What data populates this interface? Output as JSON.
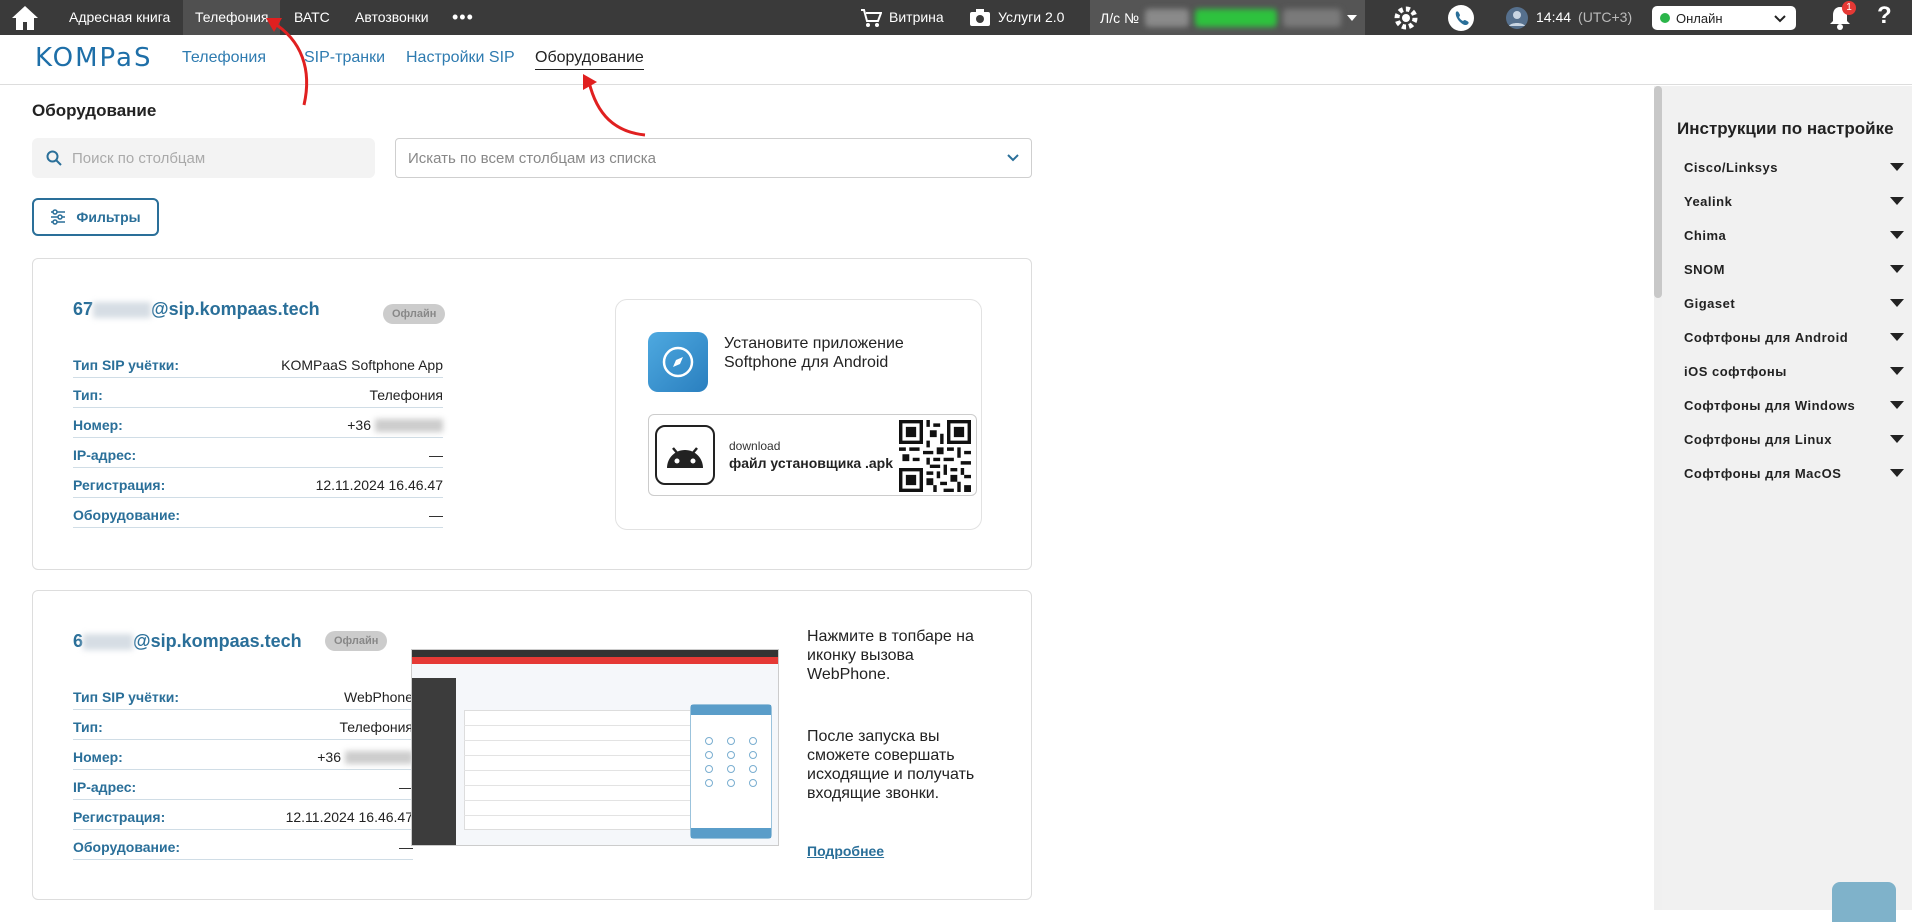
{
  "topbar": {
    "nav": [
      "Адресная книга",
      "Телефония",
      "ВАТС",
      "Автозвонки"
    ],
    "more": "•••",
    "vitrina": "Витрина",
    "services": "Услуги 2.0",
    "ls_label": "Л/с №",
    "time": "14:44",
    "tz": "(UTC+3)",
    "status": "Онлайн",
    "notif_count": "1",
    "help": "?"
  },
  "subnav": {
    "logo": "KOMPaS",
    "tabs": [
      "Телефония",
      "SIP-транки",
      "Настройки SIP",
      "Оборудование"
    ]
  },
  "main": {
    "title": "Оборудование",
    "search_placeholder": "Поиск по столбцам",
    "select_placeholder": "Искать по всем столбцам из списка",
    "filters": "Фильтры"
  },
  "cards": [
    {
      "acct_prefix": "67",
      "acct_suffix": "@sip.kompaas.tech",
      "status": "Офлайн",
      "rows": [
        {
          "label": "Тип SIP учётки:",
          "value": "KOMPaaS Softphone App"
        },
        {
          "label": "Тип:",
          "value": "Телефония"
        },
        {
          "label": "Номер:",
          "value": "+36"
        },
        {
          "label": "IP-адрес:",
          "value": "—"
        },
        {
          "label": "Регистрация:",
          "value": "12.11.2024 16.46.47"
        },
        {
          "label": "Оборудование:",
          "value": "—"
        }
      ],
      "promo_title": "Установите приложение Softphone для Android",
      "apk_small": "download",
      "apk_bold": "файл установщика .apk"
    },
    {
      "acct_prefix": "6",
      "acct_suffix": "@sip.kompaas.tech",
      "status": "Офлайн",
      "rows": [
        {
          "label": "Тип SIP учётки:",
          "value": "WebPhone"
        },
        {
          "label": "Тип:",
          "value": "Телефония"
        },
        {
          "label": "Номер:",
          "value": "+36"
        },
        {
          "label": "IP-адрес:",
          "value": "—"
        },
        {
          "label": "Регистрация:",
          "value": "12.11.2024 16.46.47"
        },
        {
          "label": "Оборудование:",
          "value": "—"
        }
      ],
      "text1": "Нажмите в топбаре на иконку вызова WebPhone.",
      "text2": "После запуска вы сможете совершать исходящие и получать входящие звонки.",
      "more": "Подробнее"
    }
  ],
  "instructions": {
    "title": "Инструкции по настройке",
    "items": [
      "Cisco/Linksys",
      "Yealink",
      "Chima",
      "SNOM",
      "Gigaset",
      "Софтфоны для Android",
      "iOS софтфоны",
      "Софтфоны для Windows",
      "Софтфоны для Linux",
      "Софтфоны для MacOS"
    ]
  },
  "colors": {
    "accent": "#2a6f99",
    "topbar": "#3a3a3a",
    "online": "#2bb54a",
    "annotation_arrow": "#e02020"
  }
}
